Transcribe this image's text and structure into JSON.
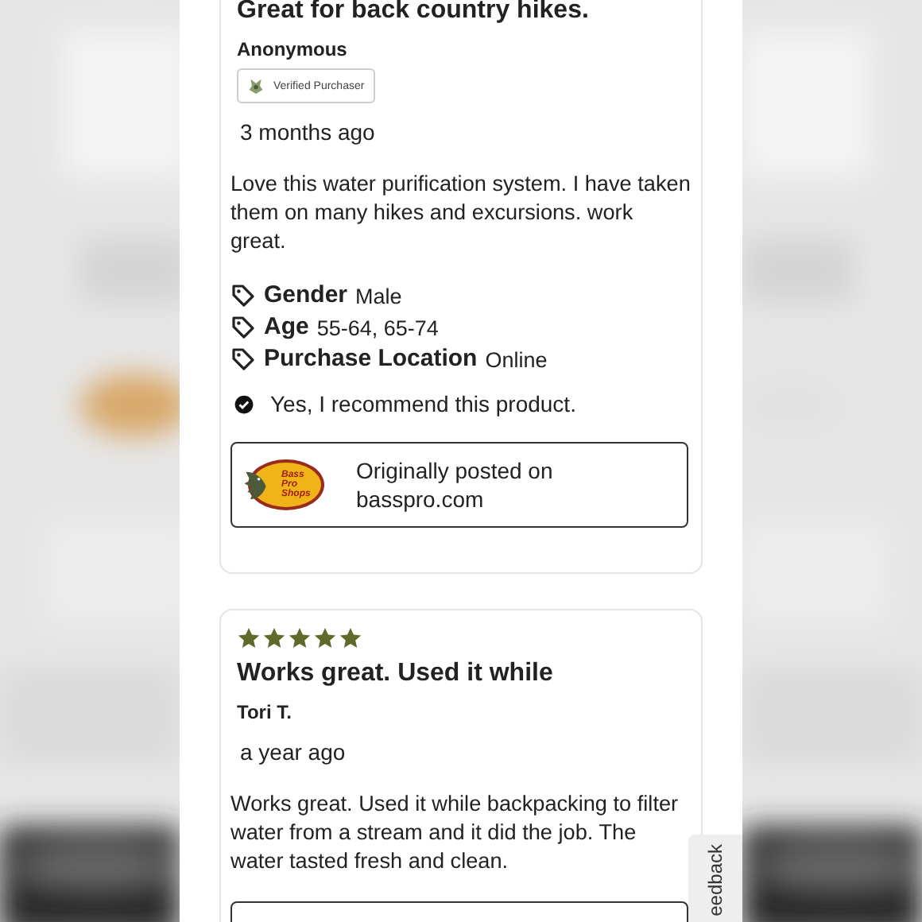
{
  "reviews": [
    {
      "title": "Great for back country hikes.",
      "author": "Anonymous",
      "badge": "Verified Purchaser",
      "time": "3 months ago",
      "body": "Love this water purification system. I have taken them on many hikes and excursions. work great.",
      "attributes": [
        {
          "label": "Gender",
          "value": "Male"
        },
        {
          "label": "Age",
          "value": "55-64, 65-74"
        },
        {
          "label": "Purchase Location",
          "value": "Online"
        }
      ],
      "recommend": "Yes, I recommend this product.",
      "source": {
        "logo_text": "Bass Pro Shops",
        "text": "Originally posted on basspro.com"
      }
    },
    {
      "stars": 5,
      "title": "Works great. Used it while",
      "author": "Tori T.",
      "time": "a year ago",
      "body": "Works great. Used it while backpacking to filter water from a stream and it did the job. The water tasted fresh and clean."
    }
  ],
  "feedback_tab": "eedback"
}
